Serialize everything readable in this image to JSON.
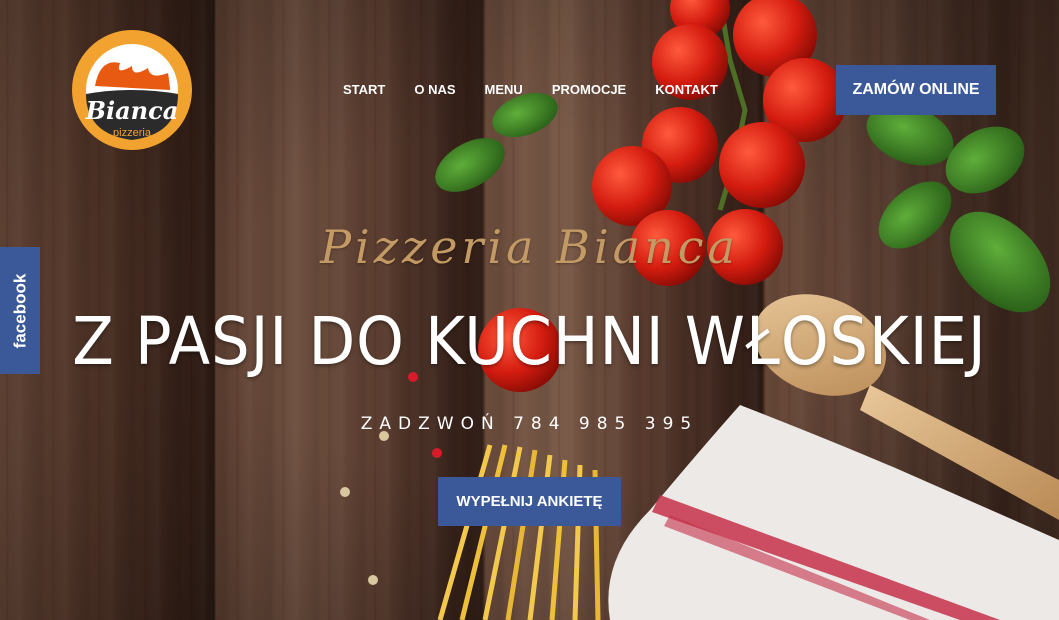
{
  "brand": {
    "logo_name": "Bianca",
    "logo_sub": "pizzeria",
    "colors": {
      "orange": "#f2a22e",
      "dark": "#2b2b2b"
    }
  },
  "nav": {
    "items": [
      "START",
      "O NAS",
      "MENU",
      "PROMOCJE",
      "KONTAKT"
    ]
  },
  "order_button": {
    "label": "ZAMÓW ONLINE"
  },
  "facebook_tab": {
    "label": "facebook"
  },
  "hero": {
    "script_title": "Pizzeria Bianca",
    "headline": "Z PASJI DO KUCHNI WŁOSKIEJ",
    "phone_text": "ZADZWOŃ 784 985 395",
    "survey_button": "WYPEŁNIJ ANKIETĘ"
  },
  "colors": {
    "button_blue": "#3b5998",
    "script_gold": "#c49a64"
  }
}
